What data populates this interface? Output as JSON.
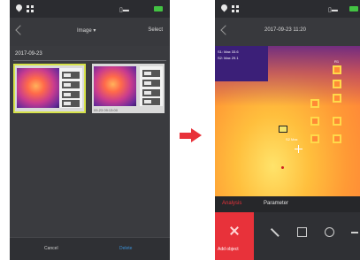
{
  "left_screen": {
    "header": {
      "title": "Image ▾",
      "action": "Select"
    },
    "date_heading": "2017-09-23",
    "thumbnails": [
      {
        "selected": true,
        "caption": ""
      },
      {
        "selected": false,
        "caption": "09-23 09:13:00"
      }
    ],
    "bottom_bar": {
      "cancel_label": "Cancel",
      "delete_label": "Delete"
    }
  },
  "right_screen": {
    "header": {
      "title": "2017-09-23 11:20"
    },
    "overlay": {
      "line1": "S1: Max 33.6",
      "line2": "S2: Max 29.1",
      "region_label": "R1",
      "marker_label": "S2 Max"
    },
    "tabs": {
      "analysis": "Analysis",
      "parameter": "Parameter"
    },
    "tools": {
      "add_label": "Add object"
    }
  },
  "colors": {
    "accent": "#e8323a",
    "selected_outline": "#d6e24a",
    "delete": "#3a8fd6",
    "battery": "#43c343"
  }
}
